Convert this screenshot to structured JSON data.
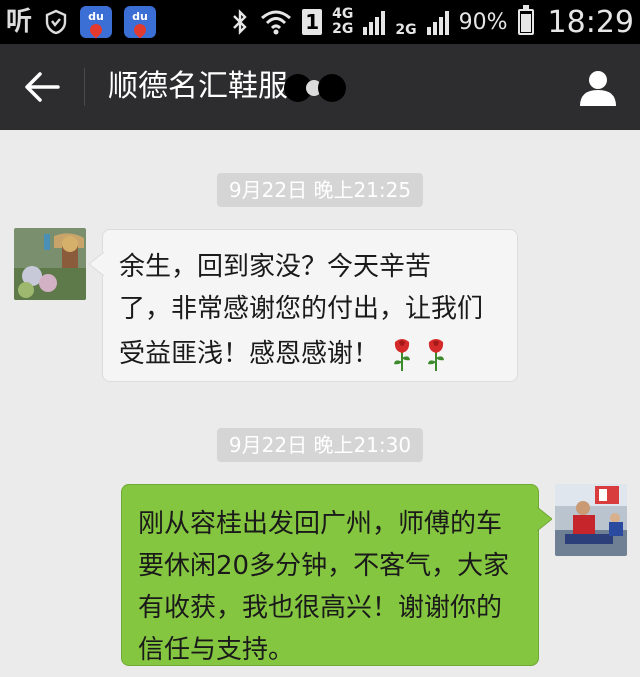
{
  "status_bar": {
    "app_label": "听",
    "net_top": "4G",
    "net_bottom": "2G",
    "net_2g": "2G",
    "sim_slot": "1",
    "battery_percent": "90%",
    "battery_level": 0.9,
    "time": "18:29",
    "du_label": "du",
    "icons": [
      "app-icon",
      "shield-icon",
      "baidu-map-icon",
      "baidu-map-icon",
      "bluetooth-icon",
      "wifi-icon",
      "sim-icon",
      "signal-icon",
      "battery-icon"
    ]
  },
  "header": {
    "title": "顺德名汇鞋服",
    "back_icon": "arrow-left-icon",
    "profile_icon": "person-icon"
  },
  "messages": [
    {
      "timestamp": "9月22日 晚上21:25",
      "direction": "incoming",
      "lines": [
        "余生，回到家没？今天辛苦",
        "了，非常感谢您的付出，让我们",
        "受益匪浅！感恩感谢！"
      ],
      "emoji": [
        "rose-icon",
        "rose-icon"
      ]
    },
    {
      "timestamp": "9月22日 晚上21:30",
      "direction": "outgoing",
      "lines": [
        "刚从容桂出发回广州，师傅的车",
        "要休闲20多分钟，不客气，大家",
        "有收获，我也很高兴！谢谢你的",
        "信任与支持。"
      ]
    }
  ],
  "colors": {
    "outgoing_bubble": "#85c640",
    "incoming_bubble": "#f5f5f5",
    "header_bg": "#2d2d2f",
    "chat_bg": "#ebebeb"
  }
}
